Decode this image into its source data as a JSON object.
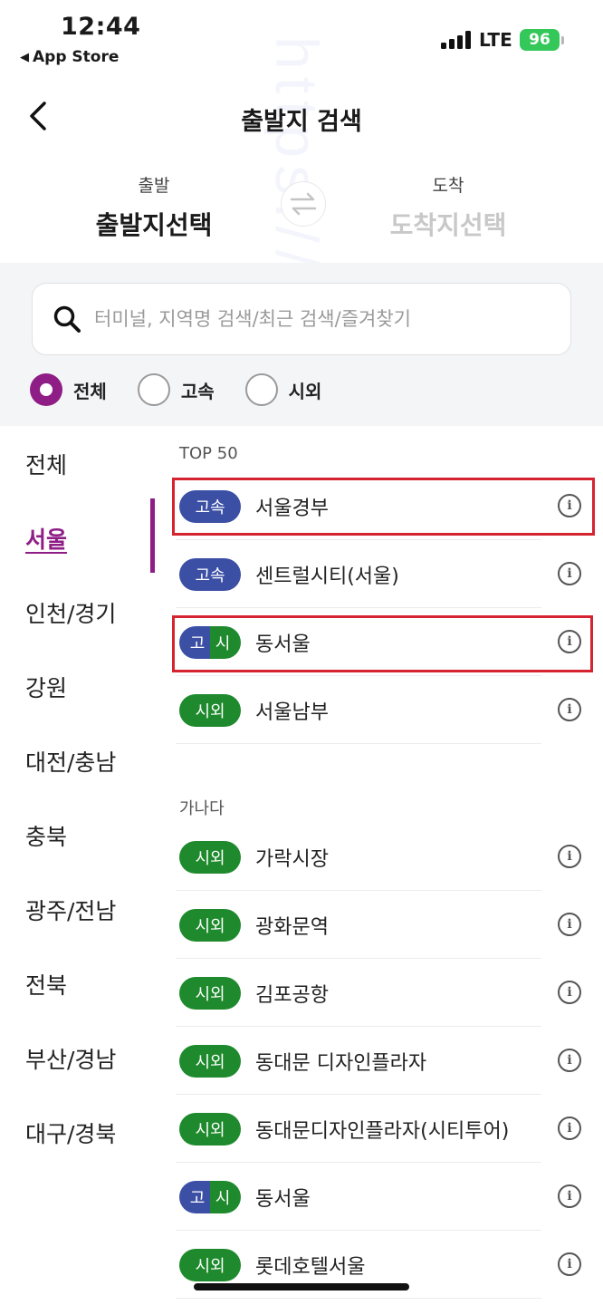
{
  "status_bar": {
    "time": "12:44",
    "back_app": "App Store",
    "network": "LTE",
    "battery": "96"
  },
  "header": {
    "title": "출발지 검색"
  },
  "route": {
    "departure_label": "출발",
    "departure_value": "출발지선택",
    "arrival_label": "도착",
    "arrival_value": "도착지선택"
  },
  "search": {
    "placeholder": "터미널, 지역명 검색/최근 검색/즐겨찾기"
  },
  "filters": [
    {
      "label": "전체",
      "selected": true
    },
    {
      "label": "고속",
      "selected": false
    },
    {
      "label": "시외",
      "selected": false
    }
  ],
  "regions": [
    {
      "label": "전체",
      "active": false
    },
    {
      "label": "서울",
      "active": true
    },
    {
      "label": "인천/경기",
      "active": false
    },
    {
      "label": "강원",
      "active": false
    },
    {
      "label": "대전/충남",
      "active": false
    },
    {
      "label": "충북",
      "active": false
    },
    {
      "label": "광주/전남",
      "active": false
    },
    {
      "label": "전북",
      "active": false
    },
    {
      "label": "부산/경남",
      "active": false
    },
    {
      "label": "대구/경북",
      "active": false
    }
  ],
  "top50": {
    "label": "TOP 50",
    "items": [
      {
        "badge": "고속",
        "type": "express",
        "name": "서울경부",
        "highlighted": true
      },
      {
        "badge": "고속",
        "type": "express",
        "name": "센트럴시티(서울)",
        "highlighted": false
      },
      {
        "badge_left": "고",
        "badge_right": "시",
        "type": "both",
        "name": "동서울",
        "highlighted": true
      },
      {
        "badge": "시외",
        "type": "intercity",
        "name": "서울남부",
        "highlighted": false
      }
    ]
  },
  "ganada": {
    "label": "가나다",
    "items": [
      {
        "badge": "시외",
        "type": "intercity",
        "name": "가락시장"
      },
      {
        "badge": "시외",
        "type": "intercity",
        "name": "광화문역"
      },
      {
        "badge": "시외",
        "type": "intercity",
        "name": "김포공항"
      },
      {
        "badge": "시외",
        "type": "intercity",
        "name": "동대문 디자인플라자"
      },
      {
        "badge": "시외",
        "type": "intercity",
        "name": "동대문디자인플라자(시티투어)"
      },
      {
        "badge_left": "고",
        "badge_right": "시",
        "type": "both",
        "name": "동서울"
      },
      {
        "badge": "시외",
        "type": "intercity",
        "name": "롯데호텔서울"
      }
    ]
  },
  "info_glyph": "i",
  "watermark": "https://hepsid.tistory.com/",
  "colors": {
    "accent": "#8e1d86",
    "express": "#3b4fa5",
    "intercity": "#1f8a2d",
    "highlight": "#d52330"
  }
}
